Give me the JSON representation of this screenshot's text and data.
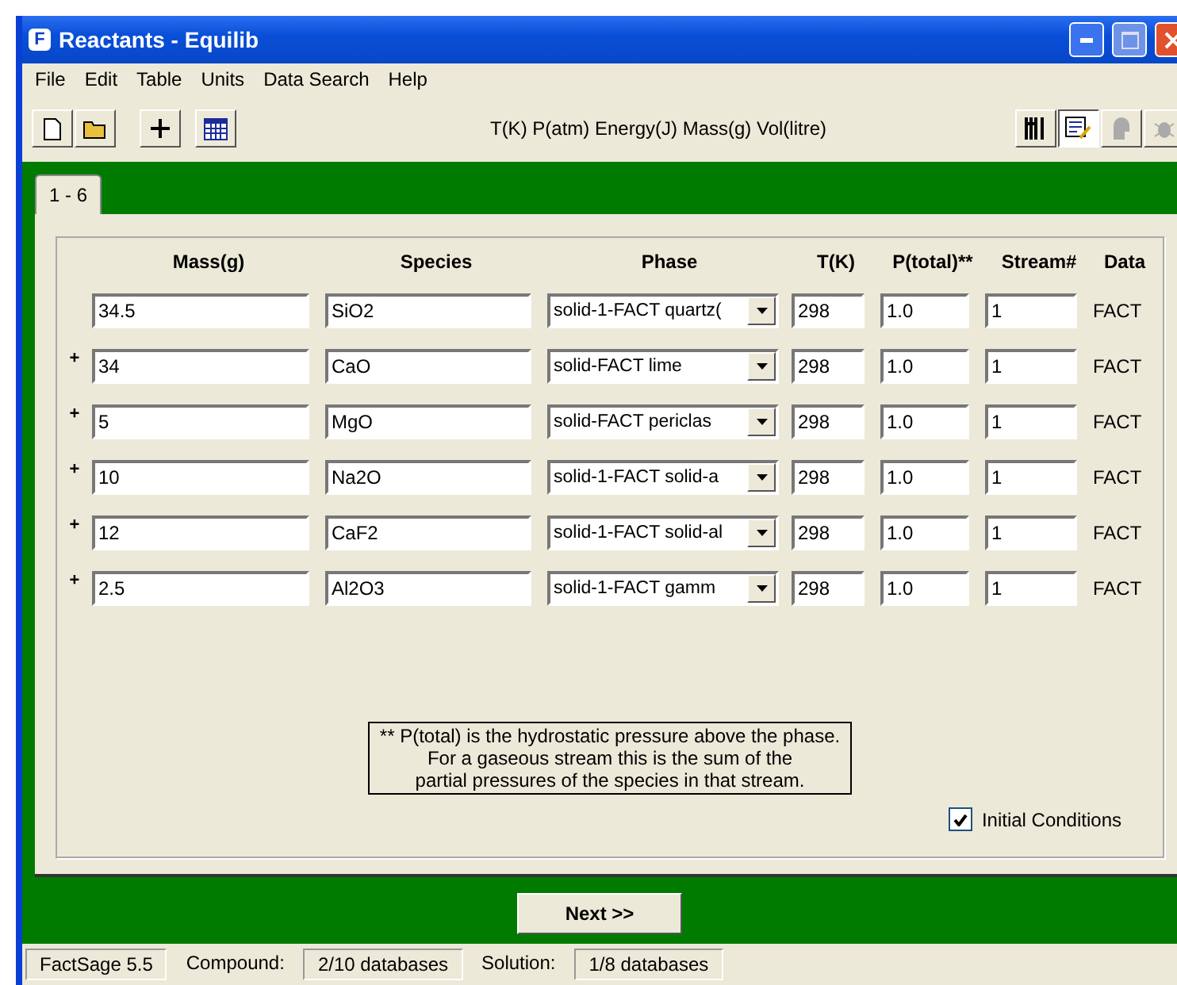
{
  "window": {
    "title": "Reactants - Equilib",
    "app_letter": "F"
  },
  "menu": [
    "File",
    "Edit",
    "Table",
    "Units",
    "Data Search",
    "Help"
  ],
  "toolbar": {
    "left": [
      {
        "kind": "new"
      },
      {
        "kind": "open"
      },
      {
        "kind": "plus"
      },
      {
        "kind": "table"
      }
    ],
    "units": "T(K)  P(atm)  Energy(J)  Mass(g)  Vol(litre)",
    "right": [
      {
        "kind": "cutlery",
        "pressed": false,
        "disabled": false
      },
      {
        "kind": "edit",
        "pressed": true,
        "disabled": false
      },
      {
        "kind": "head",
        "pressed": false,
        "disabled": true
      },
      {
        "kind": "bug",
        "pressed": false,
        "disabled": true
      }
    ]
  },
  "tabs": [
    {
      "label": "1 - 6",
      "selected": true
    }
  ],
  "columns": [
    "Mass(g)",
    "Species",
    "Phase",
    "T(K)",
    "P(total)**",
    "Stream#",
    "Data"
  ],
  "rows": [
    {
      "mass": "34.5",
      "species": "SiO2",
      "phase": "solid-1-FACT  quartz(",
      "t": "298",
      "p": "1.0",
      "stream": "1",
      "data": "FACT"
    },
    {
      "marker": "+",
      "mass": "34",
      "species": "CaO",
      "phase": "solid-FACT  lime",
      "t": "298",
      "p": "1.0",
      "stream": "1",
      "data": "FACT"
    },
    {
      "marker": "+",
      "mass": "5",
      "species": "MgO",
      "phase": "solid-FACT  periclas",
      "t": "298",
      "p": "1.0",
      "stream": "1",
      "data": "FACT"
    },
    {
      "marker": "+",
      "mass": "10",
      "species": "Na2O",
      "phase": "solid-1-FACT  solid-a",
      "t": "298",
      "p": "1.0",
      "stream": "1",
      "data": "FACT"
    },
    {
      "marker": "+",
      "mass": "12",
      "species": "CaF2",
      "phase": "solid-1-FACT  solid-al",
      "t": "298",
      "p": "1.0",
      "stream": "1",
      "data": "FACT"
    },
    {
      "marker": "+",
      "mass": "2.5",
      "species": "Al2O3",
      "phase": "solid-1-FACT  gamm",
      "t": "298",
      "p": "1.0",
      "stream": "1",
      "data": "FACT"
    }
  ],
  "note": [
    "** P(total) is the hydrostatic pressure above the phase.",
    "For a gaseous stream this is the sum of the",
    "partial pressures of the species in that stream."
  ],
  "initial_conditions": {
    "label": "Initial Conditions",
    "checked": true
  },
  "next_button": "Next >>",
  "status_bar": [
    {
      "kind": "plain",
      "text": "FactSage 5.5"
    },
    {
      "kind": "label",
      "text": "Compound:"
    },
    {
      "kind": "plain",
      "text": "2/10 databases"
    },
    {
      "kind": "label",
      "text": "Solution:"
    },
    {
      "kind": "plain",
      "text": "1/8 databases"
    }
  ]
}
